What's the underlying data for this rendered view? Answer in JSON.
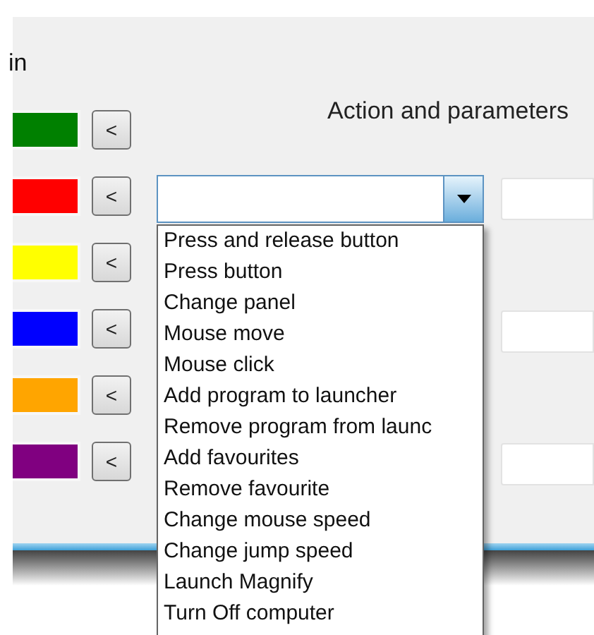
{
  "section_label": "in",
  "columns_header": "Action and parameters",
  "rows": [
    {
      "color": "#008000",
      "kind": "header",
      "param_field": false
    },
    {
      "color": "#ff0000",
      "kind": "combo",
      "param_field": true
    },
    {
      "color": "#ffff00",
      "kind": "plain",
      "param_field": false
    },
    {
      "color": "#0000ff",
      "kind": "plain",
      "param_field": true
    },
    {
      "color": "#ffa500",
      "kind": "plain",
      "param_field": false
    },
    {
      "color": "#800080",
      "kind": "plain",
      "param_field": true
    }
  ],
  "back_button": "<",
  "dropdown": {
    "options": [
      "Press and release button",
      "Press button",
      "Change panel",
      "Mouse move",
      "Mouse click",
      "Add program to launcher",
      "Remove program from launc",
      "Add favourites",
      "Remove favourite",
      "Change mouse speed",
      "Change jump speed",
      "Launch Magnify",
      "Turn Off computer"
    ]
  }
}
